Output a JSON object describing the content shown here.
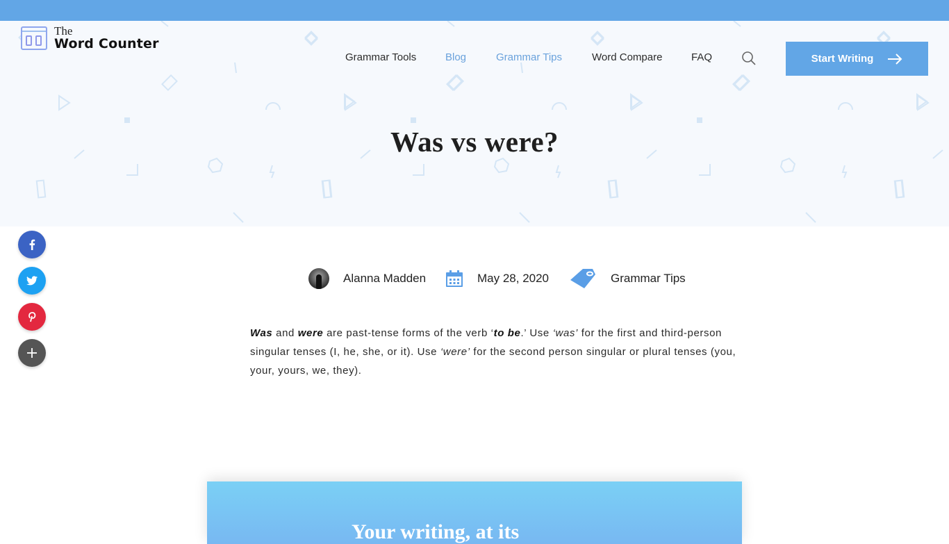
{
  "site": {
    "logo_line1": "The",
    "logo_line2": "Word Counter"
  },
  "nav": {
    "items": [
      {
        "label": "Grammar Tools",
        "highlight": false
      },
      {
        "label": "Blog",
        "highlight": true
      },
      {
        "label": "Grammar Tips",
        "highlight": true
      },
      {
        "label": "Word Compare",
        "highlight": false
      },
      {
        "label": "FAQ",
        "highlight": false
      }
    ],
    "search_icon": "search-icon",
    "cta_label": "Start Writing",
    "cta_icon": "arrow-right-icon"
  },
  "article": {
    "title": "Was vs were?",
    "author": "Alanna Madden",
    "date": "May 28, 2020",
    "category": "Grammar Tips",
    "intro": {
      "t1": "Was",
      "t2": " and ",
      "t3": "were",
      "t4": " are past-tense forms of the verb ‘",
      "t5": "to be",
      "t6": ".’ Use ",
      "t7": "‘was’",
      "t8": " for the first and third-person singular tenses (I, he, she, or it). Use ",
      "t9": "‘were’",
      "t10": " for the second person singular or plural tenses (you, your, yours, we, they)."
    }
  },
  "share": {
    "buttons": [
      {
        "name": "facebook",
        "glyph": "f",
        "color": "#3b63c4"
      },
      {
        "name": "twitter",
        "glyph": "t",
        "color": "#1da1f2"
      },
      {
        "name": "pinterest",
        "glyph": "p",
        "color": "#e3283f"
      },
      {
        "name": "more",
        "glyph": "+",
        "color": "#555555"
      }
    ]
  },
  "promo": {
    "headline": "Your writing, at its"
  },
  "colors": {
    "accent": "#62a6e6",
    "nav_highlight": "#6aa2dc",
    "hero_bg": "#f6f9fd"
  }
}
